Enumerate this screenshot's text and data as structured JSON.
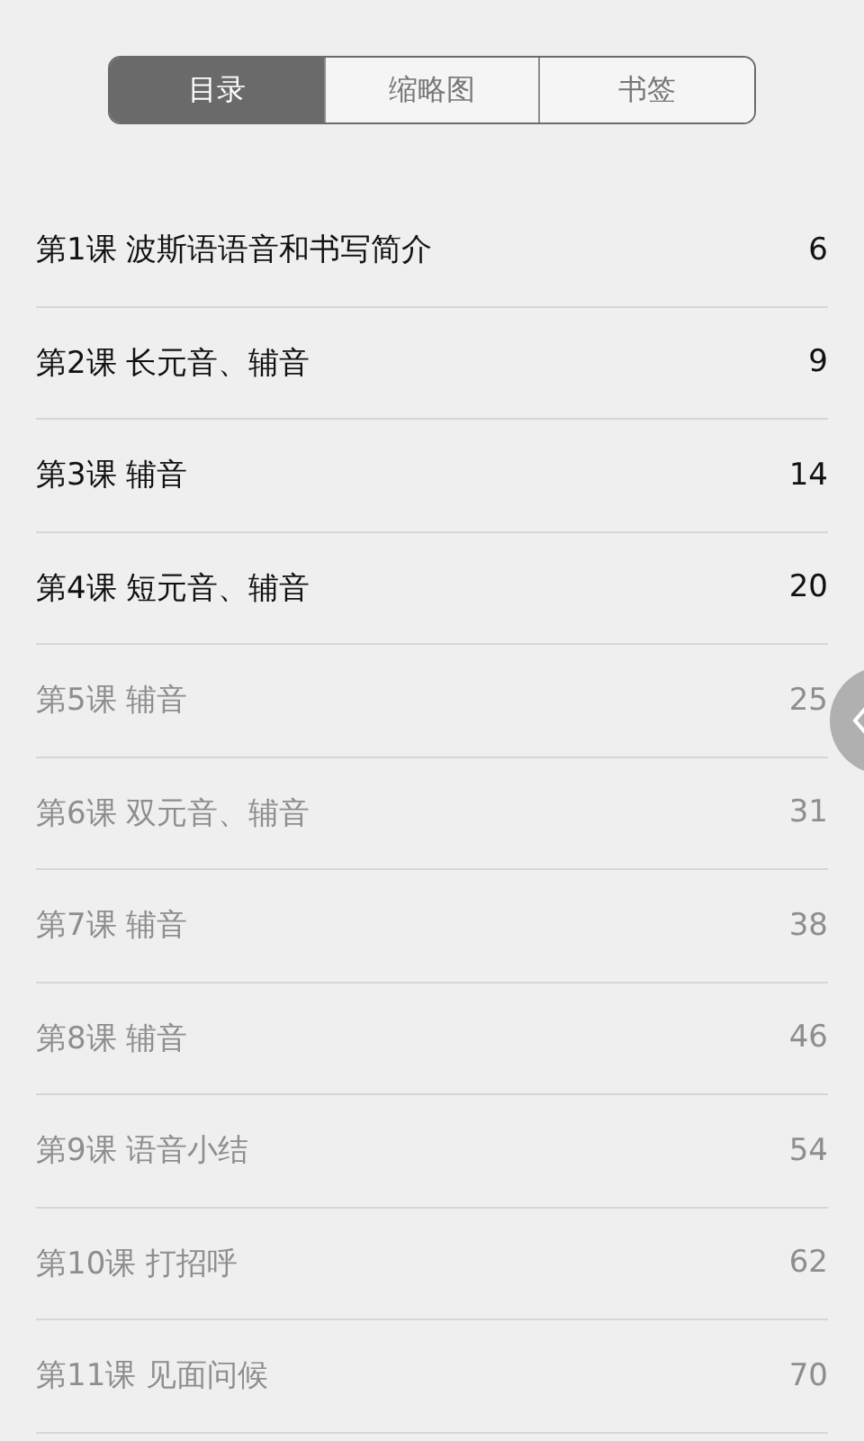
{
  "tabs": [
    {
      "label": "目录",
      "selected": true
    },
    {
      "label": "缩略图",
      "selected": false
    },
    {
      "label": "书签",
      "selected": false
    }
  ],
  "lessons": [
    {
      "title": "第1课 波斯语语音和书写简介",
      "page": "6",
      "available": true
    },
    {
      "title": "第2课 长元音、辅音",
      "page": "9",
      "available": true
    },
    {
      "title": "第3课 辅音",
      "page": "14",
      "available": true
    },
    {
      "title": "第4课 短元音、辅音",
      "page": "20",
      "available": true
    },
    {
      "title": "第5课 辅音",
      "page": "25",
      "available": false
    },
    {
      "title": "第6课 双元音、辅音",
      "page": "31",
      "available": false
    },
    {
      "title": "第7课 辅音",
      "page": "38",
      "available": false
    },
    {
      "title": "第8课 辅音",
      "page": "46",
      "available": false
    },
    {
      "title": "第9课 语音小结",
      "page": "54",
      "available": false
    },
    {
      "title": "第10课 打招呼",
      "page": "62",
      "available": false
    },
    {
      "title": "第11课 见面问候",
      "page": "70",
      "available": false
    }
  ]
}
